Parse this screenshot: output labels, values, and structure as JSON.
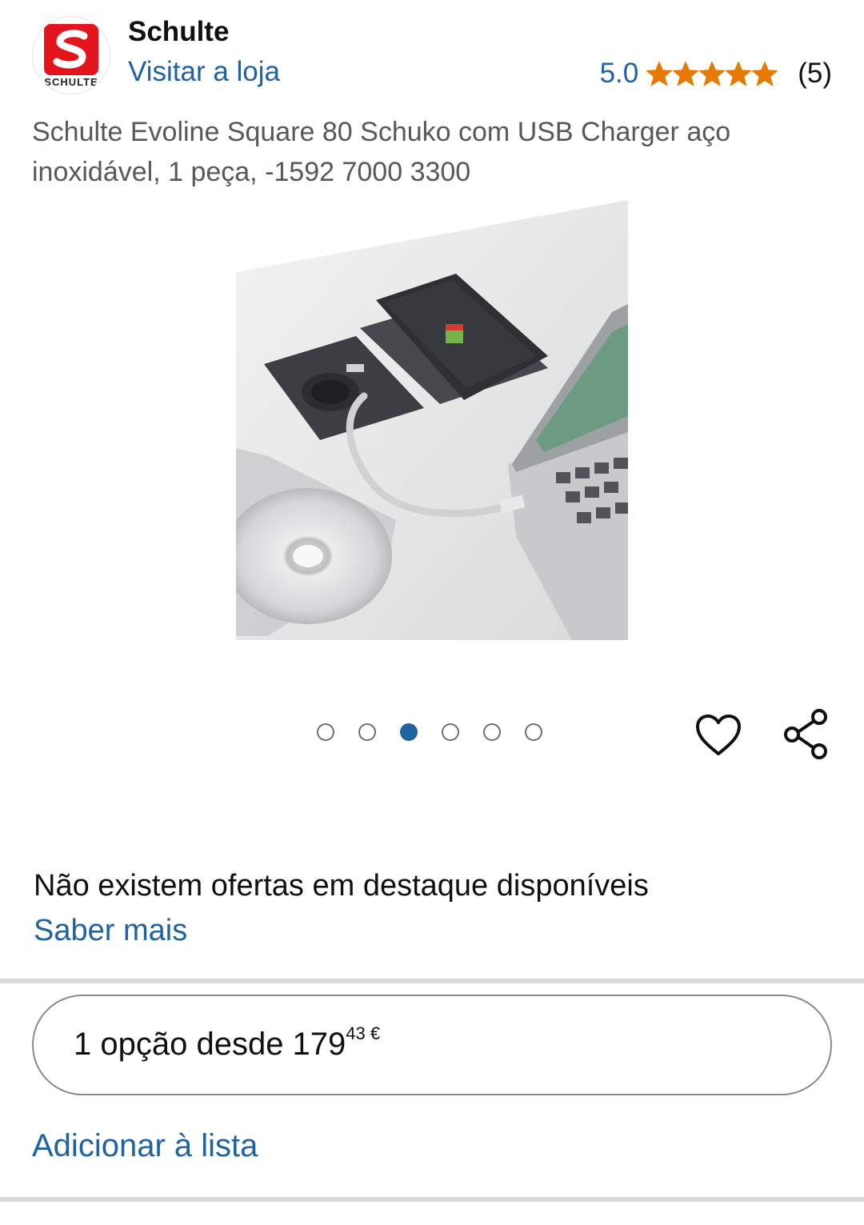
{
  "brand": {
    "name": "Schulte",
    "logo_text": "SCHULTE",
    "visit_store_label": "Visitar a loja"
  },
  "rating": {
    "value": "5.0",
    "stars": 5,
    "count": "(5)",
    "star_color": "#E67A00"
  },
  "product": {
    "title": "Schulte Evoline Square 80 Schuko com USB Charger aço inoxidável, 1 peça, -1592 7000 3300"
  },
  "carousel": {
    "total_images": 6,
    "active_index": 2
  },
  "actions": {
    "wishlist_icon": "heart-icon",
    "share_icon": "share-icon"
  },
  "offers": {
    "no_offers_text": "Não existem ofertas em destaque disponíveis",
    "learn_more_label": "Saber mais",
    "options_text": "1 opção desde 179",
    "price_fraction": "43",
    "currency": "€"
  },
  "add_to_list_label": "Adicionar à lista",
  "colors": {
    "link": "#2162A1",
    "text": "#0F1111",
    "muted": "#565959",
    "divider": "#D5D9D9",
    "logo_red": "#E3141B"
  }
}
